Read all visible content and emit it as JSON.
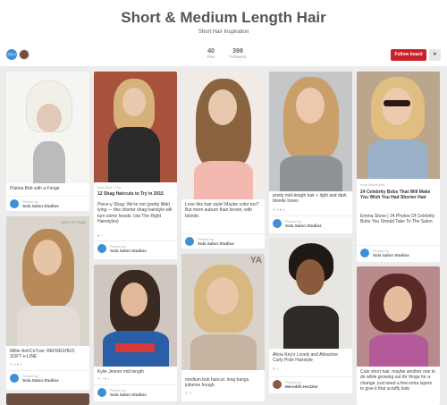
{
  "board": {
    "title": "Short & Medium Length Hair",
    "description": "Short Hair Inspiration",
    "owner_avatar_text": "SOLA",
    "stats": {
      "pins_num": "40",
      "pins_label": "Pins",
      "followers_num": "398",
      "followers_label": "Followers"
    },
    "follow_label": "Follow board",
    "send_icon": "paper-plane-icon"
  },
  "pinned_by_label": "Pinned by",
  "colors": {
    "accent": "#cb2027",
    "background": "#ececec",
    "avatar": "#3d8fd6"
  },
  "pins": [
    {
      "desc": "Platina Bob with a Fringe",
      "pinner": "Sola Salon Studios"
    },
    {
      "source": "from Bob + Co",
      "desc": "12 Shag Haircuts to Try in 2015",
      "desc2": "Piece-y Shag: We're not (pretty little) lying — this shorter shag hairstyle will turn some heads. (via The Right Hairstyles)",
      "pinner": "Sola Salon Studios",
      "stats": "♥ 7"
    },
    {
      "desc": "Love this hair style! Maybe color too? But more auburn than brown, with blonde.",
      "pinner": "Sola Salon Studios"
    },
    {
      "desc": "pretty mid-length hair + light and dark blonde tones",
      "stats": "↻ 6  ♥ 3",
      "pinner": "Sola Salon Studios"
    },
    {
      "source": "from BuzzFeed",
      "desc": "24 Celebrity Bobs That Will Make You Wish You Had Shorter Hair",
      "desc2": "Emma Stone | 24 Photos Of Celebrity Bobs You Should Take To The Salon",
      "pinner": "Sola Salon Studios"
    },
    {
      "overlay": "AHN CO TRAN",
      "desc": "Miller AnhCoTran: REFRESHED. SOFT-n-LINE",
      "stats": "↻ 9  ♥ 2",
      "pinner": "Sola Salon Studios"
    },
    {
      "desc": "Kylie Jenner mid length",
      "stats": "↻ 7  ♥ 1",
      "pinner": "Sola Salon Studios"
    },
    {
      "overlay": "YA",
      "desc": "medium bob haircut. long bangs. julianne hough.",
      "stats": "↻ 3",
      "pinner": "Sola Salon Studios"
    },
    {
      "desc": "Alicia Key's Lovely and Attractive Curly Pixie Hairstyle",
      "stats": "↻ 1",
      "pinner": "Meredith Hertzler"
    },
    {
      "desc": "Cute short hair. maybe another one to do while growing out thr fringe for a change. just need a few extra layers to give it that scruffy look",
      "pinner": ""
    }
  ]
}
